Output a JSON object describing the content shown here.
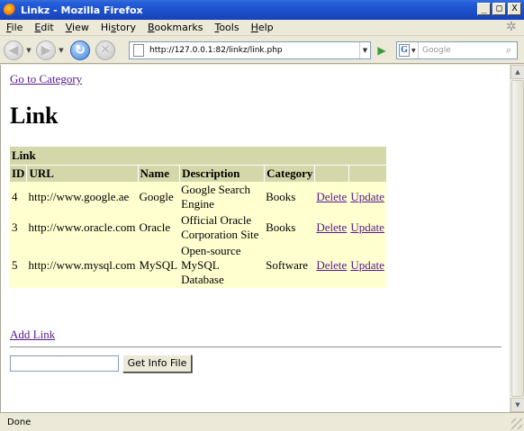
{
  "window": {
    "title": "Linkz - Mozilla Firefox",
    "buttons": [
      "_",
      "□",
      "X"
    ]
  },
  "menu": [
    {
      "acc": "F",
      "rest": "ile"
    },
    {
      "acc": "E",
      "rest": "dit"
    },
    {
      "acc": "V",
      "rest": "iew"
    },
    {
      "pre": "Hi",
      "acc": "s",
      "rest": "tory"
    },
    {
      "acc": "B",
      "rest": "ookmarks"
    },
    {
      "acc": "T",
      "rest": "ools"
    },
    {
      "acc": "H",
      "rest": "elp"
    }
  ],
  "toolbar": {
    "url": "http://127.0.0.1:82/linkz/link.php",
    "search_placeholder": "Google"
  },
  "page": {
    "goto_category": "Go to Category",
    "heading": "Link",
    "table_caption": "Link",
    "headers": [
      "ID",
      "URL",
      "Name",
      "Description",
      "Category",
      "",
      ""
    ],
    "rows": [
      {
        "id": "4",
        "url": "http://www.google.ae",
        "name": "Google",
        "desc1": "Google Search",
        "desc2": "Engine",
        "desc3": "",
        "category": "Books",
        "delete": "Delete",
        "update": "Update"
      },
      {
        "id": "3",
        "url": "http://www.oracle.com",
        "name": "Oracle",
        "desc1": "Official Oracle",
        "desc2": "Corporation Site",
        "desc3": "",
        "category": "Books",
        "delete": "Delete",
        "update": "Update"
      },
      {
        "id": "5",
        "url": "http://www.mysql.com",
        "name": "MySQL",
        "desc1": "Open-source",
        "desc2": "MySQL",
        "desc3": "Database",
        "category": "Software",
        "delete": "Delete",
        "update": "Update"
      }
    ],
    "add_link": "Add Link",
    "file_input_value": "",
    "info_button": "Get Info File"
  },
  "status": {
    "text": "Done"
  }
}
